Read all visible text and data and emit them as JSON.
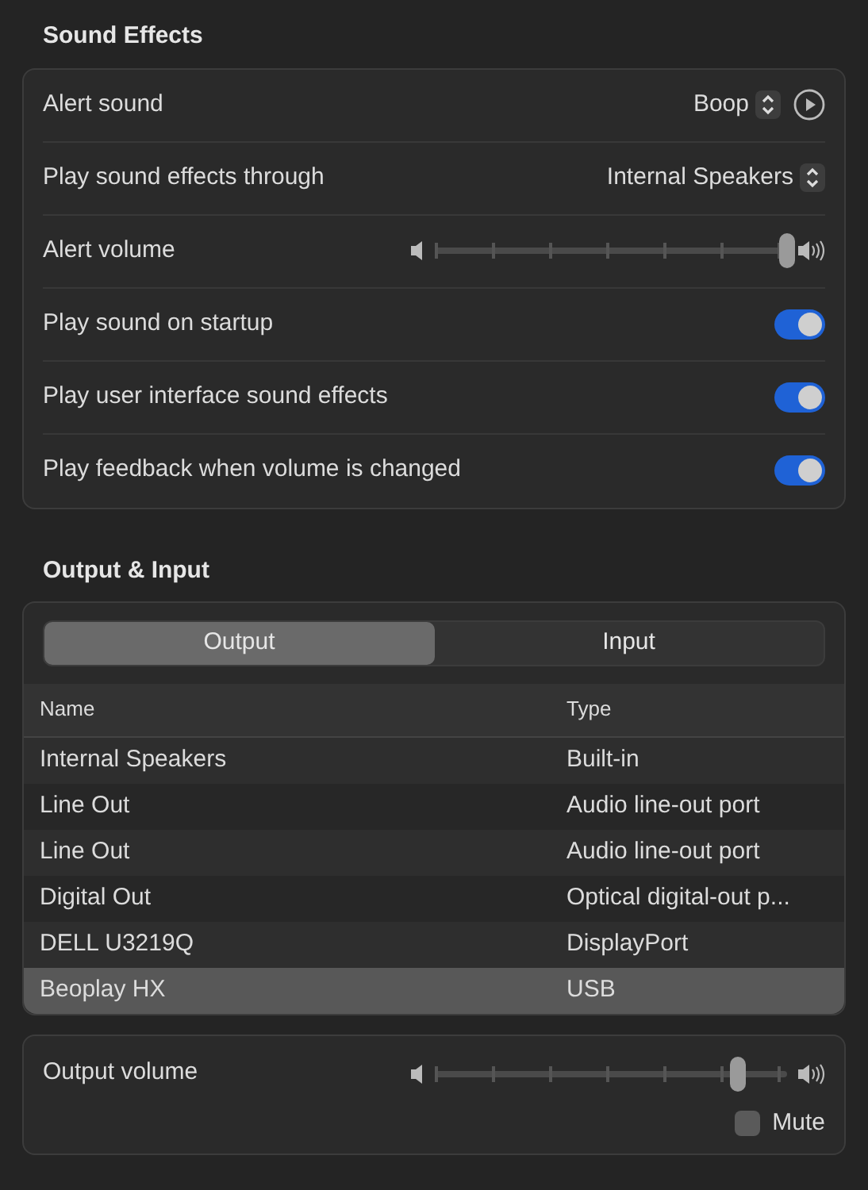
{
  "sound_effects": {
    "title": "Sound Effects",
    "rows": [
      {
        "kind": "popup",
        "label": "Alert sound",
        "value": "Boop",
        "play_button": true
      },
      {
        "kind": "popup",
        "label": "Play sound effects through",
        "value": "Internal Speakers"
      },
      {
        "kind": "slider",
        "label": "Alert volume",
        "level": 1.0
      },
      {
        "kind": "toggle",
        "label": "Play sound on startup",
        "on": true
      },
      {
        "kind": "toggle",
        "label": "Play user interface sound effects",
        "on": true
      },
      {
        "kind": "toggle",
        "label": "Play feedback when volume is changed",
        "on": true
      }
    ]
  },
  "output_input": {
    "title": "Output & Input",
    "tabs": [
      {
        "label": "Output",
        "selected": true
      },
      {
        "label": "Input",
        "selected": false
      }
    ],
    "table": {
      "columns": [
        "Name",
        "Type"
      ],
      "rows": [
        {
          "cells": [
            "Internal Speakers",
            "Built-in"
          ],
          "selected": false
        },
        {
          "cells": [
            "Line Out",
            "Audio line-out port"
          ],
          "selected": false
        },
        {
          "cells": [
            "Line Out",
            "Audio line-out port"
          ],
          "selected": false
        },
        {
          "cells": [
            "Digital Out",
            "Optical digital-out p..."
          ],
          "selected": false
        },
        {
          "cells": [
            "DELL U3219Q",
            "DisplayPort"
          ],
          "selected": false
        },
        {
          "cells": [
            "Beoplay HX",
            "USB"
          ],
          "selected": true
        }
      ]
    }
  },
  "output_volume": {
    "label": "Output volume",
    "level": 0.86,
    "mute": {
      "label": "Mute",
      "checked": false
    }
  }
}
